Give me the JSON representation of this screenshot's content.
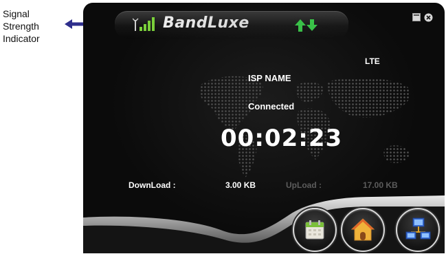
{
  "callout": {
    "lines": [
      "Signal",
      "Strength",
      "Indicator"
    ]
  },
  "app": {
    "brand": "BandLuxe",
    "network_type": "LTE",
    "isp_name": "ISP NAME",
    "status": "Connected",
    "timer": "00:02:23",
    "download_label": "DownLoad :",
    "download_value": "3.00 KB",
    "upload_label": "UpLoad :",
    "upload_value": "17.00 KB"
  },
  "colors": {
    "signal": "#7bd23a",
    "up_arrow": "#39d24a",
    "down_arrow": "#39d24a",
    "callout_arrow": "#2e2e8c"
  },
  "icons": {
    "signal": "signal-bars-icon",
    "traffic": "up-down-arrows-icon",
    "minimize": "minimize-icon",
    "close": "close-icon",
    "calendar": "calendar-icon",
    "home": "home-icon",
    "network": "network-icon"
  }
}
